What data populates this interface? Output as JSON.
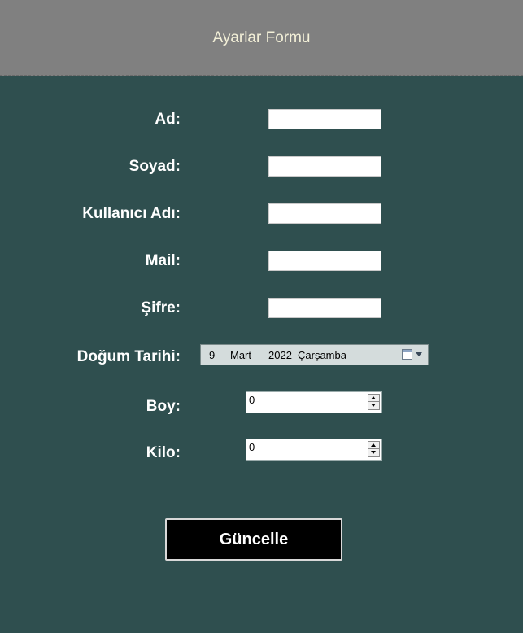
{
  "header": {
    "title": "Ayarlar Formu"
  },
  "form": {
    "ad": {
      "label": "Ad:",
      "value": ""
    },
    "soyad": {
      "label": "Soyad:",
      "value": ""
    },
    "kullanici_adi": {
      "label": "Kullanıcı Adı:",
      "value": ""
    },
    "mail": {
      "label": "Mail:",
      "value": ""
    },
    "sifre": {
      "label": "Şifre:",
      "value": ""
    },
    "dogum_tarihi": {
      "label": "Doğum Tarihi:",
      "day": "9",
      "month": "Mart",
      "year": "2022",
      "weekday": "Çarşamba"
    },
    "boy": {
      "label": "Boy:",
      "value": "0"
    },
    "kilo": {
      "label": "Kilo:",
      "value": "0"
    }
  },
  "actions": {
    "update_label": "Güncelle"
  },
  "icons": {
    "calendar": "calendar-icon",
    "dropdown": "chevron-down-icon",
    "spin_up": "arrow-up-icon",
    "spin_down": "arrow-down-icon"
  },
  "colors": {
    "background": "#2f4f4f",
    "header": "#808080",
    "header_text": "#f3f0d8",
    "button_bg": "#000000"
  }
}
